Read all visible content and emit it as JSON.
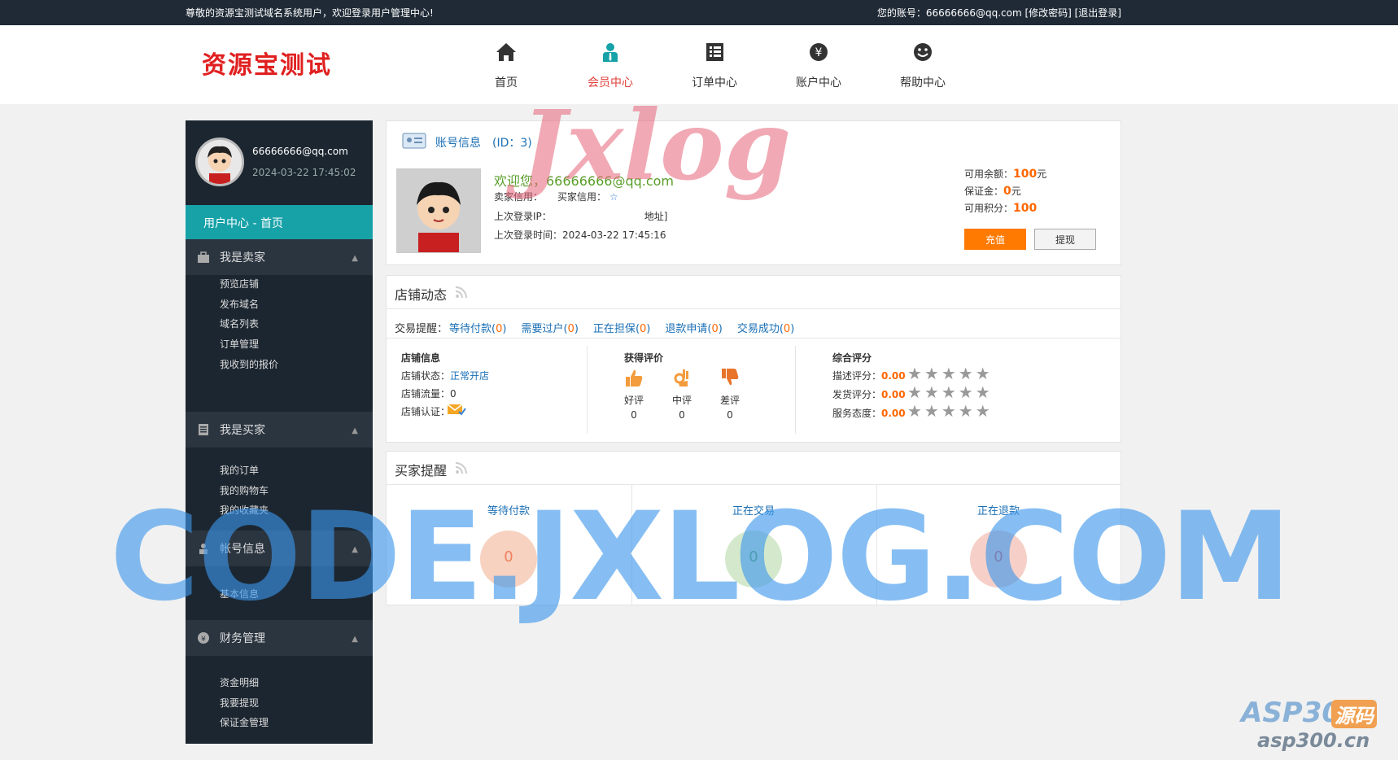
{
  "topbar": {
    "welcome": "尊敬的资源宝测试域名系统用户，欢迎登录用户管理中心!",
    "account_info": "您的账号：66666666@qq.com [修改密码] [退出登录]"
  },
  "header": {
    "logo": "资源宝测试",
    "nav": [
      {
        "label": "首页",
        "icon": "home-icon"
      },
      {
        "label": "会员中心",
        "icon": "member-icon"
      },
      {
        "label": "订单中心",
        "icon": "order-list-icon"
      },
      {
        "label": "账户中心",
        "icon": "yuan-icon"
      },
      {
        "label": "帮助中心",
        "icon": "smile-icon"
      }
    ],
    "active_color": "#e0403b"
  },
  "sidebar": {
    "email": "66666666@qq.com",
    "time": "2024-03-22 17:45:02",
    "home": "用户中心 - 首页",
    "groups": [
      {
        "label": "我是卖家",
        "links": [
          "预览店铺",
          "发布域名",
          "域名列表",
          "订单管理",
          "我收到的报价"
        ]
      },
      {
        "label": "我是买家",
        "links": [
          "我的订单",
          "我的购物车",
          "我的收藏夹"
        ]
      },
      {
        "label": "帐号信息",
        "links": [
          "基本信息"
        ]
      },
      {
        "label": "财务管理",
        "links": [
          "资金明细",
          "我要提现",
          "保证金管理"
        ]
      }
    ],
    "accent": "#17a2a8"
  },
  "account": {
    "title": "账号信息　(ID：3)",
    "welcome": "欢迎您，66666666@qq.com",
    "credit_line": "卖家信用：　　买家信用：",
    "last_ip": "上次登录IP：　　　　　　　　　　地址]",
    "last_time": "上次登录时间：2024-03-22 17:45:16",
    "balance_label": "可用余额：",
    "balance_value": "100",
    "balance_unit": "元",
    "deposit_label": "保证金：",
    "deposit_value": "0",
    "deposit_unit": "元",
    "points_label": "可用积分：",
    "points_value": "100",
    "recharge": "充值",
    "withdraw": "提现"
  },
  "shop": {
    "title": "店铺动态",
    "trade_label": "交易提醒：",
    "trades": [
      {
        "label": "等待付款",
        "count": "0"
      },
      {
        "label": "需要过户",
        "count": "0"
      },
      {
        "label": "正在担保",
        "count": "0"
      },
      {
        "label": "退款申请",
        "count": "0"
      },
      {
        "label": "交易成功",
        "count": "0"
      }
    ],
    "info_title": "店铺信息",
    "status_label": "店铺状态：",
    "status_value": "正常开店",
    "traffic_label": "店铺流量：",
    "traffic_value": "0",
    "cert_label": "店铺认证：",
    "review_title": "获得评价",
    "reviews": [
      {
        "label": "好评",
        "count": "0"
      },
      {
        "label": "中评",
        "count": "0"
      },
      {
        "label": "差评",
        "count": "0"
      }
    ],
    "score_title": "综合评分",
    "scores": [
      {
        "label": "描述评分：",
        "value": "0.00",
        "stars": 0
      },
      {
        "label": "发货评分：",
        "value": "0.00",
        "stars": 0
      },
      {
        "label": "服务态度：",
        "value": "0.00",
        "stars": 0
      }
    ]
  },
  "buyer": {
    "title": "买家提醒",
    "cols": [
      {
        "label": "等待付款",
        "count": "0",
        "color": "#f7c9b4"
      },
      {
        "label": "正在交易",
        "count": "0",
        "color": "#cfe6c8"
      },
      {
        "label": "正在退款",
        "count": "0",
        "color": "#f7cbc4"
      }
    ]
  },
  "watermarks": {
    "big": "CODE.JXLOG.COM",
    "jx": "Jxlog",
    "asp": "ASP300",
    "asp_cn": "源码",
    "asp_url": "asp300.cn"
  }
}
